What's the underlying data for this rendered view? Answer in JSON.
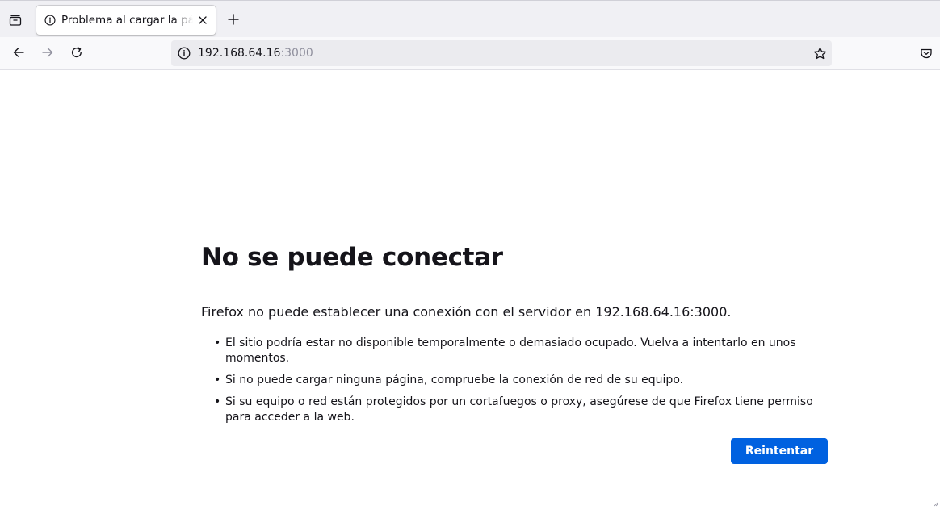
{
  "browser": {
    "tab": {
      "title": "Problema al cargar la página"
    },
    "url": {
      "host": "192.168.64.16",
      "port": ":3000"
    },
    "icons": {
      "list_all_tabs": "list-all-tabs-icon",
      "tab_info": "info-icon",
      "tab_close": "close-icon",
      "new_tab": "plus-icon",
      "back": "back-arrow-icon",
      "forward": "forward-arrow-icon",
      "reload": "reload-icon",
      "site_info": "info-icon",
      "bookmark": "star-icon",
      "pocket": "pocket-icon"
    }
  },
  "error": {
    "title": "No se puede conectar",
    "description": "Firefox no puede establecer una conexión con el servidor en 192.168.64.16:3000.",
    "items": [
      "El sitio podría estar no disponible temporalmente o demasiado ocupado. Vuelva a intentarlo en unos momentos.",
      "Si no puede cargar ninguna página, compruebe la conexión de red de su equipo.",
      "Si su equipo o red están protegidos por un cortafuegos o proxy, asegúrese de que Firefox tiene permiso para acceder a la web."
    ],
    "retry_label": "Reintentar"
  },
  "colors": {
    "accent": "#0061e0",
    "text": "#15141a",
    "muted": "#8f8f9d"
  }
}
